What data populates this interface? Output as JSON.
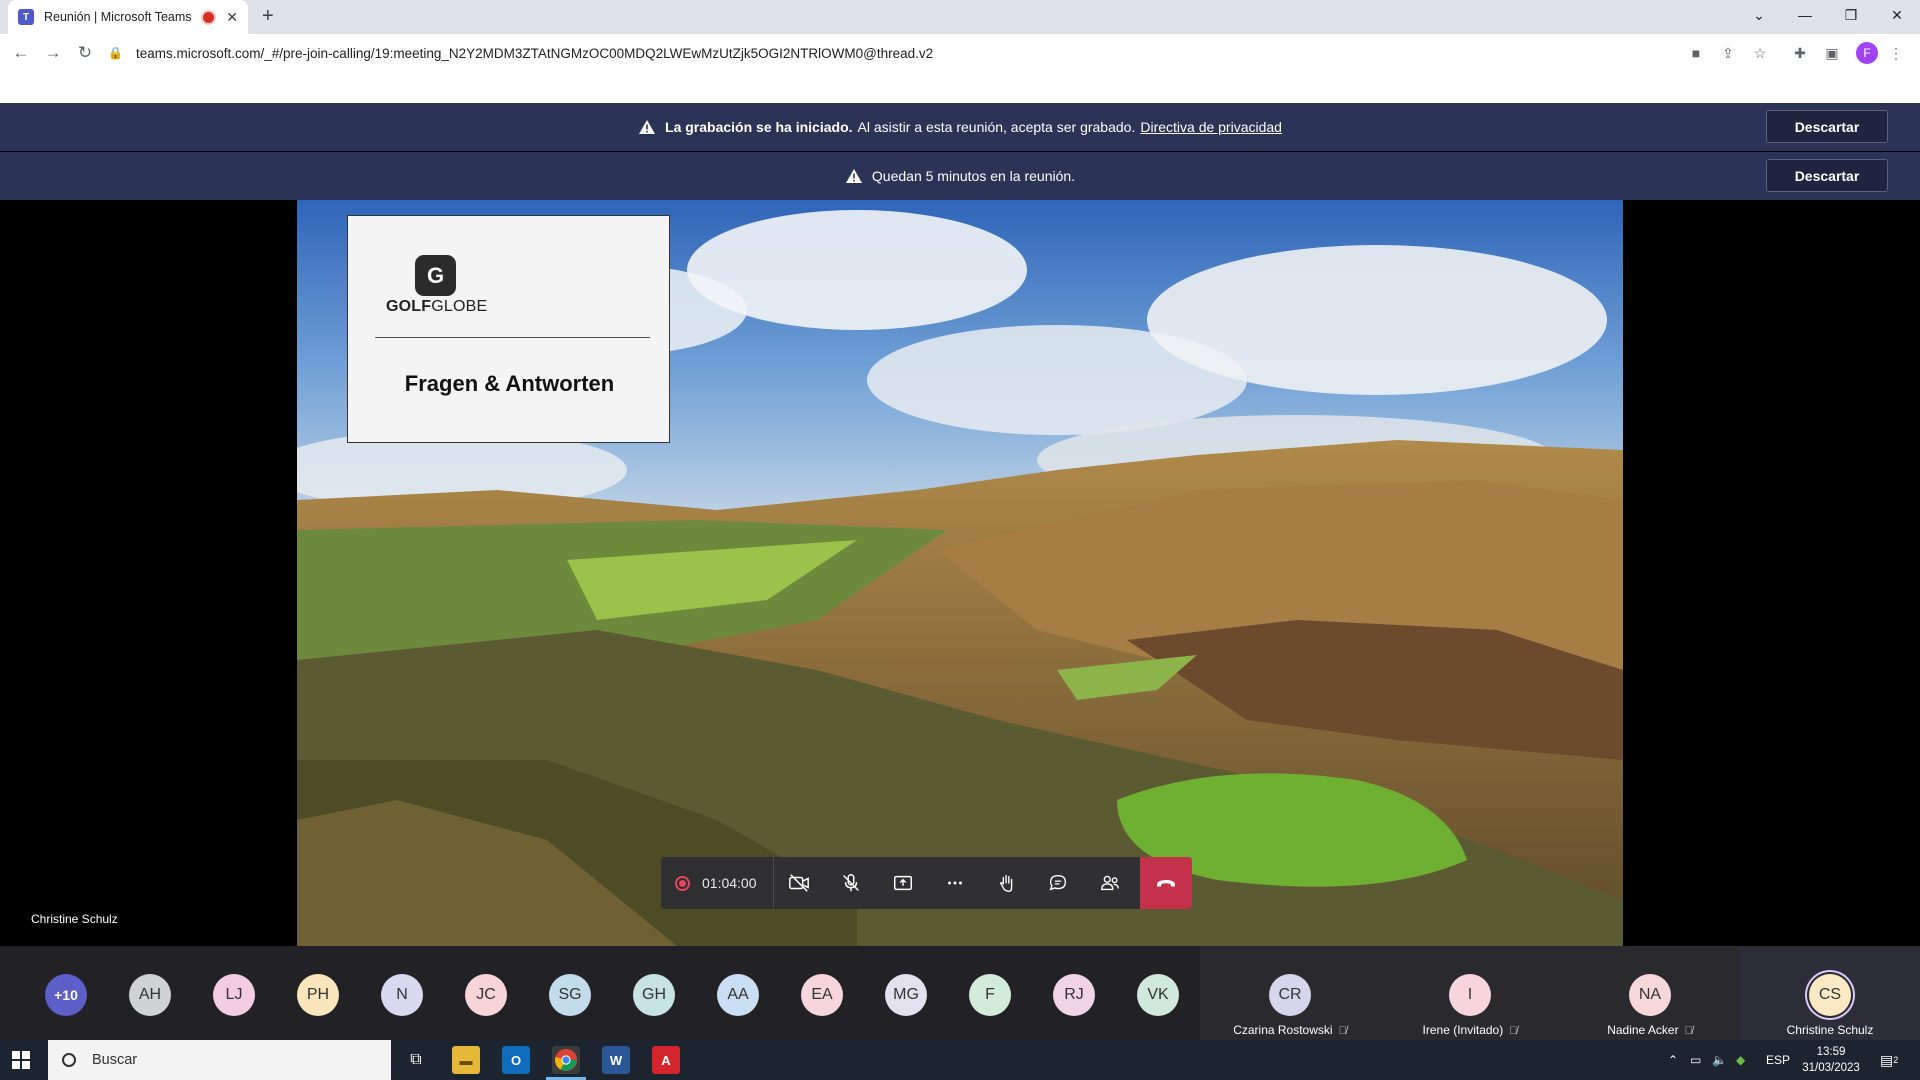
{
  "browser": {
    "tab_title": "Reunión | Microsoft Teams",
    "url": "teams.microsoft.com/_#/pre-join-calling/19:meeting_N2Y2MDM3ZTAtNGMzOC00MDQ2LWEwMzUtZjk5OGI2NTRlOWM0@thread.v2",
    "profile_initial": "F"
  },
  "banners": {
    "recording": {
      "bold": "La grabación se ha iniciado.",
      "text": "Al asistir a esta reunión, acepta ser grabado.",
      "link": "Directiva de privacidad",
      "dismiss": "Descartar"
    },
    "time_left": {
      "text": "Quedan 5 minutos en la reunión.",
      "dismiss": "Descartar"
    }
  },
  "stage": {
    "presenter_name": "Christine Schulz",
    "slide": {
      "logo_bold": "GOLF",
      "logo_rest": "GLOBE",
      "title": "Fragen & Antworten"
    }
  },
  "controls": {
    "elapsed": "01:04:00",
    "icons": [
      "camera-off-icon",
      "mic-off-icon",
      "share-screen-icon",
      "more-icon",
      "raise-hand-icon",
      "chat-icon",
      "participants-icon",
      "hang-up-icon"
    ]
  },
  "participants": {
    "overflow": "+10",
    "avatars": [
      {
        "initials": "AH",
        "color": "#cfd3d6"
      },
      {
        "initials": "LJ",
        "color": "#f2cde2"
      },
      {
        "initials": "PH",
        "color": "#fbe5bd"
      },
      {
        "initials": "N",
        "color": "#d9d8f0"
      },
      {
        "initials": "JC",
        "color": "#f6d4d8"
      },
      {
        "initials": "SG",
        "color": "#c3dcec"
      },
      {
        "initials": "GH",
        "color": "#c7e3e1"
      },
      {
        "initials": "AA",
        "color": "#c9def2"
      },
      {
        "initials": "EA",
        "color": "#f7d5dc"
      },
      {
        "initials": "MG",
        "color": "#e3e1ee"
      },
      {
        "initials": "F",
        "color": "#d3ecd9"
      },
      {
        "initials": "RJ",
        "color": "#f1d3e6"
      },
      {
        "initials": "VK",
        "color": "#d1e8dc"
      }
    ],
    "tiles": [
      {
        "initials": "CR",
        "name": "Czarina Rostowski",
        "color": "#d5d6ec"
      },
      {
        "initials": "I",
        "name": "Irene (Invitado)",
        "color": "#f6d5dc"
      },
      {
        "initials": "NA",
        "name": "Nadine Acker",
        "color": "#f7d7d9"
      },
      {
        "initials": "CS",
        "name": "Christine Schulz",
        "color": "#fbe9c5"
      }
    ]
  },
  "taskbar": {
    "search_placeholder": "Buscar",
    "language": "ESP",
    "time": "13:59",
    "date": "31/03/2023",
    "notifications": "2"
  }
}
